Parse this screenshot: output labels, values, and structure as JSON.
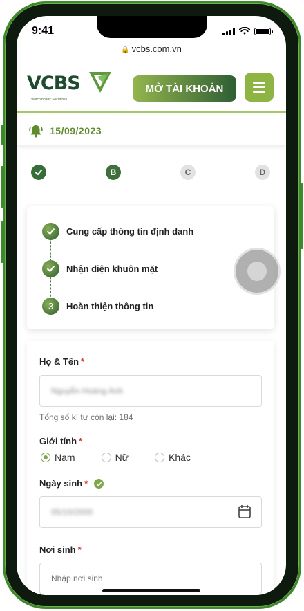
{
  "status_bar": {
    "time": "9:41"
  },
  "browser": {
    "url": "vcbs.com.vn"
  },
  "header": {
    "logo_text": "VCBS",
    "logo_subtitle": "Vietcombank Securities",
    "open_account_label": "MỞ TÀI KHOẢN"
  },
  "datebar": {
    "date": "15/09/2023"
  },
  "steps": {
    "items": [
      {
        "label": "",
        "state": "done"
      },
      {
        "label": "B",
        "state": "active"
      },
      {
        "label": "C",
        "state": "idle"
      },
      {
        "label": "D",
        "state": "idle"
      }
    ]
  },
  "sub_steps": {
    "items": [
      {
        "marker": "",
        "label": "Cung cấp thông tin định danh",
        "state": "done"
      },
      {
        "marker": "",
        "label": "Nhận diện khuôn mặt",
        "state": "done"
      },
      {
        "marker": "3",
        "label": "Hoàn thiện thông tin",
        "state": "current"
      }
    ]
  },
  "form": {
    "name_label": "Họ & Tên",
    "name_value": "Nguyễn Hoàng Anh",
    "required_mark": "*",
    "char_count_hint": "Tổng số kí tự còn lại: 184",
    "gender_label": "Giới tính",
    "gender_options": [
      "Nam",
      "Nữ",
      "Khác"
    ],
    "gender_selected": "Nam",
    "dob_label": "Ngày sinh",
    "dob_value": "05/10/2000",
    "pob_label": "Nơi sinh",
    "pob_placeholder": "Nhập nơi sinh"
  },
  "colors": {
    "brand_green": "#3f6f3b",
    "accent_green": "#8eb543",
    "required_red": "#d23b3b"
  }
}
